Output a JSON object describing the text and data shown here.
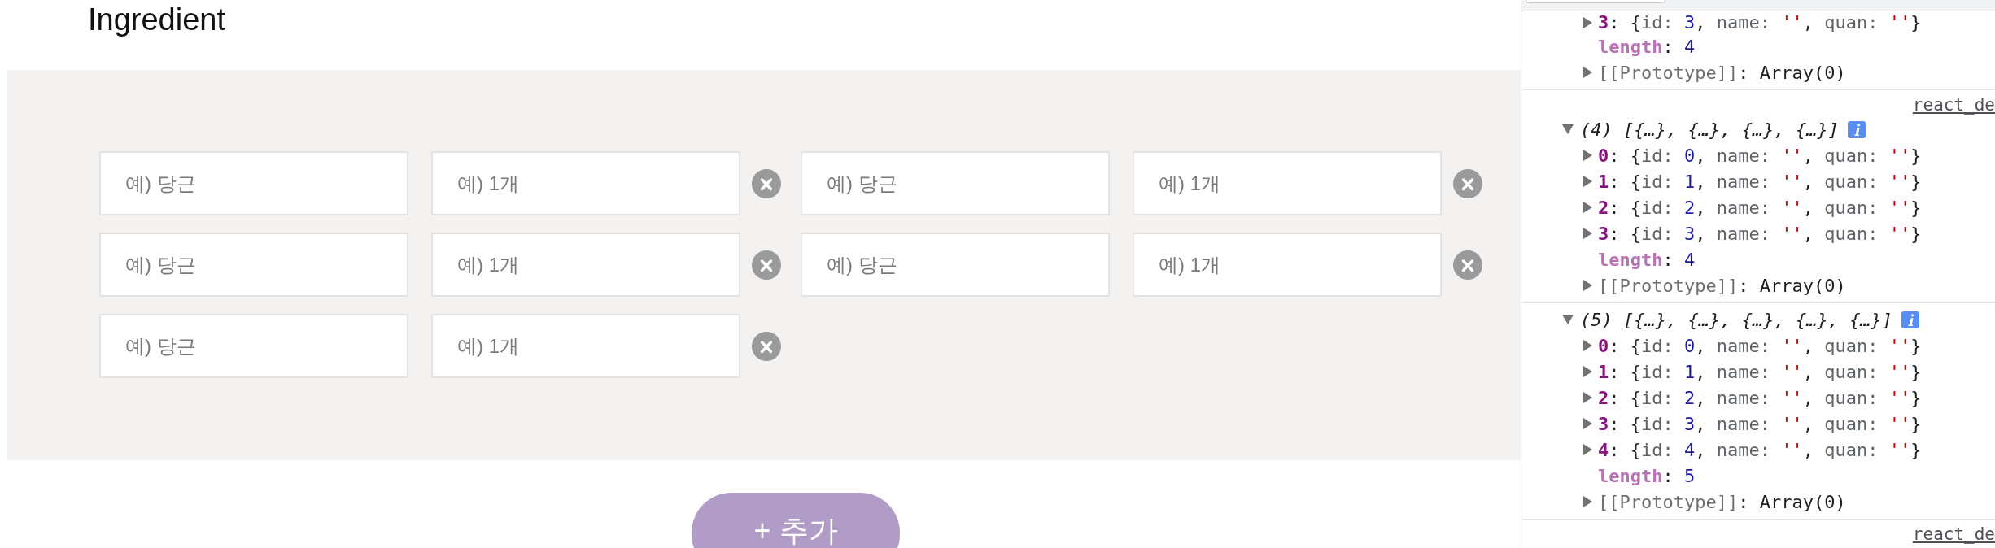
{
  "page": {
    "title": "Ingredient",
    "ingredients": [
      {
        "name": {
          "placeholder": "예) 당근"
        },
        "quantity": {
          "placeholder": "예) 1개"
        }
      },
      {
        "name": {
          "placeholder": "예) 당근"
        },
        "quantity": {
          "placeholder": "예) 1개"
        }
      },
      {
        "name": {
          "placeholder": "예) 당근"
        },
        "quantity": {
          "placeholder": "예) 1개"
        }
      },
      {
        "name": {
          "placeholder": "예) 당근"
        },
        "quantity": {
          "placeholder": "예) 1개"
        }
      },
      {
        "name": {
          "placeholder": "예) 당근"
        },
        "quantity": {
          "placeholder": "예) 1개"
        }
      }
    ],
    "add_button": {
      "label": "+ 추가"
    }
  },
  "devtools": {
    "console": {
      "messages": [
        {
          "children": [
            {
              "kind": "item",
              "expanded": false,
              "segments": [
                {
                  "text": "3",
                  "kind": "index"
                },
                {
                  "text": ": {",
                  "kind": "punct"
                },
                {
                  "text": "id: ",
                  "kind": "prop"
                },
                {
                  "text": "3",
                  "kind": "number"
                },
                {
                  "text": ", ",
                  "kind": "punct"
                },
                {
                  "text": "name: ",
                  "kind": "prop"
                },
                {
                  "text": "''",
                  "kind": "string"
                },
                {
                  "text": ", ",
                  "kind": "punct"
                },
                {
                  "text": "quan: ",
                  "kind": "prop"
                },
                {
                  "text": "''",
                  "kind": "string"
                },
                {
                  "text": "}",
                  "kind": "punct"
                }
              ]
            },
            {
              "kind": "length",
              "segments": [
                {
                  "text": "length",
                  "kind": "length"
                },
                {
                  "text": ": ",
                  "kind": "punct"
                },
                {
                  "text": "4",
                  "kind": "number"
                }
              ]
            },
            {
              "kind": "prototype",
              "expanded": false,
              "segments": [
                {
                  "text": "[[Prototype]]",
                  "kind": "proto"
                },
                {
                  "text": ": Array(0)",
                  "kind": "punct"
                }
              ]
            }
          ]
        },
        {
          "source": "react_de",
          "summary": "(4) [{…}, {…}, {…}, {…}]",
          "expanded": true,
          "children": [
            {
              "kind": "item",
              "expanded": false,
              "segments": [
                {
                  "text": "0",
                  "kind": "index"
                },
                {
                  "text": ": {",
                  "kind": "punct"
                },
                {
                  "text": "id: ",
                  "kind": "prop"
                },
                {
                  "text": "0",
                  "kind": "number"
                },
                {
                  "text": ", ",
                  "kind": "punct"
                },
                {
                  "text": "name: ",
                  "kind": "prop"
                },
                {
                  "text": "''",
                  "kind": "string"
                },
                {
                  "text": ", ",
                  "kind": "punct"
                },
                {
                  "text": "quan: ",
                  "kind": "prop"
                },
                {
                  "text": "''",
                  "kind": "string"
                },
                {
                  "text": "}",
                  "kind": "punct"
                }
              ]
            },
            {
              "kind": "item",
              "expanded": false,
              "segments": [
                {
                  "text": "1",
                  "kind": "index"
                },
                {
                  "text": ": {",
                  "kind": "punct"
                },
                {
                  "text": "id: ",
                  "kind": "prop"
                },
                {
                  "text": "1",
                  "kind": "number"
                },
                {
                  "text": ", ",
                  "kind": "punct"
                },
                {
                  "text": "name: ",
                  "kind": "prop"
                },
                {
                  "text": "''",
                  "kind": "string"
                },
                {
                  "text": ", ",
                  "kind": "punct"
                },
                {
                  "text": "quan: ",
                  "kind": "prop"
                },
                {
                  "text": "''",
                  "kind": "string"
                },
                {
                  "text": "}",
                  "kind": "punct"
                }
              ]
            },
            {
              "kind": "item",
              "expanded": false,
              "segments": [
                {
                  "text": "2",
                  "kind": "index"
                },
                {
                  "text": ": {",
                  "kind": "punct"
                },
                {
                  "text": "id: ",
                  "kind": "prop"
                },
                {
                  "text": "2",
                  "kind": "number"
                },
                {
                  "text": ", ",
                  "kind": "punct"
                },
                {
                  "text": "name: ",
                  "kind": "prop"
                },
                {
                  "text": "''",
                  "kind": "string"
                },
                {
                  "text": ", ",
                  "kind": "punct"
                },
                {
                  "text": "quan: ",
                  "kind": "prop"
                },
                {
                  "text": "''",
                  "kind": "string"
                },
                {
                  "text": "}",
                  "kind": "punct"
                }
              ]
            },
            {
              "kind": "item",
              "expanded": false,
              "segments": [
                {
                  "text": "3",
                  "kind": "index"
                },
                {
                  "text": ": {",
                  "kind": "punct"
                },
                {
                  "text": "id: ",
                  "kind": "prop"
                },
                {
                  "text": "3",
                  "kind": "number"
                },
                {
                  "text": ", ",
                  "kind": "punct"
                },
                {
                  "text": "name: ",
                  "kind": "prop"
                },
                {
                  "text": "''",
                  "kind": "string"
                },
                {
                  "text": ", ",
                  "kind": "punct"
                },
                {
                  "text": "quan: ",
                  "kind": "prop"
                },
                {
                  "text": "''",
                  "kind": "string"
                },
                {
                  "text": "}",
                  "kind": "punct"
                }
              ]
            },
            {
              "kind": "length",
              "segments": [
                {
                  "text": "length",
                  "kind": "length"
                },
                {
                  "text": ": ",
                  "kind": "punct"
                },
                {
                  "text": "4",
                  "kind": "number"
                }
              ]
            },
            {
              "kind": "prototype",
              "expanded": false,
              "segments": [
                {
                  "text": "[[Prototype]]",
                  "kind": "proto"
                },
                {
                  "text": ": Array(0)",
                  "kind": "punct"
                }
              ]
            }
          ]
        },
        {
          "summary": "(5) [{…}, {…}, {…}, {…}, {…}]",
          "expanded": true,
          "children": [
            {
              "kind": "item",
              "expanded": false,
              "segments": [
                {
                  "text": "0",
                  "kind": "index"
                },
                {
                  "text": ": {",
                  "kind": "punct"
                },
                {
                  "text": "id: ",
                  "kind": "prop"
                },
                {
                  "text": "0",
                  "kind": "number"
                },
                {
                  "text": ", ",
                  "kind": "punct"
                },
                {
                  "text": "name: ",
                  "kind": "prop"
                },
                {
                  "text": "''",
                  "kind": "string"
                },
                {
                  "text": ", ",
                  "kind": "punct"
                },
                {
                  "text": "quan: ",
                  "kind": "prop"
                },
                {
                  "text": "''",
                  "kind": "string"
                },
                {
                  "text": "}",
                  "kind": "punct"
                }
              ]
            },
            {
              "kind": "item",
              "expanded": false,
              "segments": [
                {
                  "text": "1",
                  "kind": "index"
                },
                {
                  "text": ": {",
                  "kind": "punct"
                },
                {
                  "text": "id: ",
                  "kind": "prop"
                },
                {
                  "text": "1",
                  "kind": "number"
                },
                {
                  "text": ", ",
                  "kind": "punct"
                },
                {
                  "text": "name: ",
                  "kind": "prop"
                },
                {
                  "text": "''",
                  "kind": "string"
                },
                {
                  "text": ", ",
                  "kind": "punct"
                },
                {
                  "text": "quan: ",
                  "kind": "prop"
                },
                {
                  "text": "''",
                  "kind": "string"
                },
                {
                  "text": "}",
                  "kind": "punct"
                }
              ]
            },
            {
              "kind": "item",
              "expanded": false,
              "segments": [
                {
                  "text": "2",
                  "kind": "index"
                },
                {
                  "text": ": {",
                  "kind": "punct"
                },
                {
                  "text": "id: ",
                  "kind": "prop"
                },
                {
                  "text": "2",
                  "kind": "number"
                },
                {
                  "text": ", ",
                  "kind": "punct"
                },
                {
                  "text": "name: ",
                  "kind": "prop"
                },
                {
                  "text": "''",
                  "kind": "string"
                },
                {
                  "text": ", ",
                  "kind": "punct"
                },
                {
                  "text": "quan: ",
                  "kind": "prop"
                },
                {
                  "text": "''",
                  "kind": "string"
                },
                {
                  "text": "}",
                  "kind": "punct"
                }
              ]
            },
            {
              "kind": "item",
              "expanded": false,
              "segments": [
                {
                  "text": "3",
                  "kind": "index"
                },
                {
                  "text": ": {",
                  "kind": "punct"
                },
                {
                  "text": "id: ",
                  "kind": "prop"
                },
                {
                  "text": "3",
                  "kind": "number"
                },
                {
                  "text": ", ",
                  "kind": "punct"
                },
                {
                  "text": "name: ",
                  "kind": "prop"
                },
                {
                  "text": "''",
                  "kind": "string"
                },
                {
                  "text": ", ",
                  "kind": "punct"
                },
                {
                  "text": "quan: ",
                  "kind": "prop"
                },
                {
                  "text": "''",
                  "kind": "string"
                },
                {
                  "text": "}",
                  "kind": "punct"
                }
              ]
            },
            {
              "kind": "item",
              "expanded": false,
              "segments": [
                {
                  "text": "4",
                  "kind": "index"
                },
                {
                  "text": ": {",
                  "kind": "punct"
                },
                {
                  "text": "id: ",
                  "kind": "prop"
                },
                {
                  "text": "4",
                  "kind": "number"
                },
                {
                  "text": ", ",
                  "kind": "punct"
                },
                {
                  "text": "name: ",
                  "kind": "prop"
                },
                {
                  "text": "''",
                  "kind": "string"
                },
                {
                  "text": ", ",
                  "kind": "punct"
                },
                {
                  "text": "quan: ",
                  "kind": "prop"
                },
                {
                  "text": "''",
                  "kind": "string"
                },
                {
                  "text": "}",
                  "kind": "punct"
                }
              ]
            },
            {
              "kind": "length",
              "segments": [
                {
                  "text": "length",
                  "kind": "length"
                },
                {
                  "text": ": ",
                  "kind": "punct"
                },
                {
                  "text": "5",
                  "kind": "number"
                }
              ]
            },
            {
              "kind": "prototype",
              "expanded": false,
              "segments": [
                {
                  "text": "[[Prototype]]",
                  "kind": "proto"
                },
                {
                  "text": ": Array(0)",
                  "kind": "punct"
                }
              ]
            }
          ]
        },
        {
          "source": "react_de"
        }
      ]
    }
  }
}
